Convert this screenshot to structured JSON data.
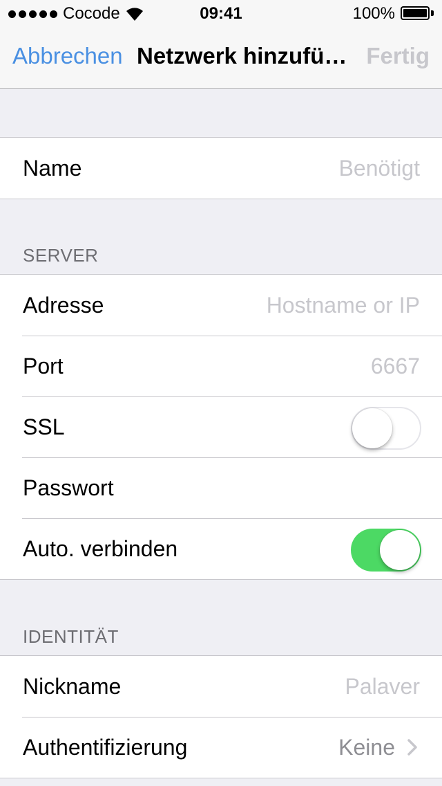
{
  "status_bar": {
    "carrier": "Cocode",
    "time": "09:41",
    "battery": "100%"
  },
  "nav": {
    "cancel": "Abbrechen",
    "title": "Netzwerk hinzufü…",
    "done": "Fertig"
  },
  "name_row": {
    "label": "Name",
    "placeholder": "Benötigt"
  },
  "server": {
    "header": "SERVER",
    "address": {
      "label": "Adresse",
      "placeholder": "Hostname or IP"
    },
    "port": {
      "label": "Port",
      "placeholder": "6667"
    },
    "ssl": {
      "label": "SSL",
      "enabled": false
    },
    "password": {
      "label": "Passwort"
    },
    "auto_connect": {
      "label": "Auto. verbinden",
      "enabled": true
    }
  },
  "identity": {
    "header": "IDENTITÄT",
    "nickname": {
      "label": "Nickname",
      "placeholder": "Palaver"
    },
    "auth": {
      "label": "Authentifizierung",
      "value": "Keine"
    }
  },
  "colors": {
    "accent": "#4a90e2",
    "switch_on": "#4cd964",
    "background": "#efeff4"
  }
}
